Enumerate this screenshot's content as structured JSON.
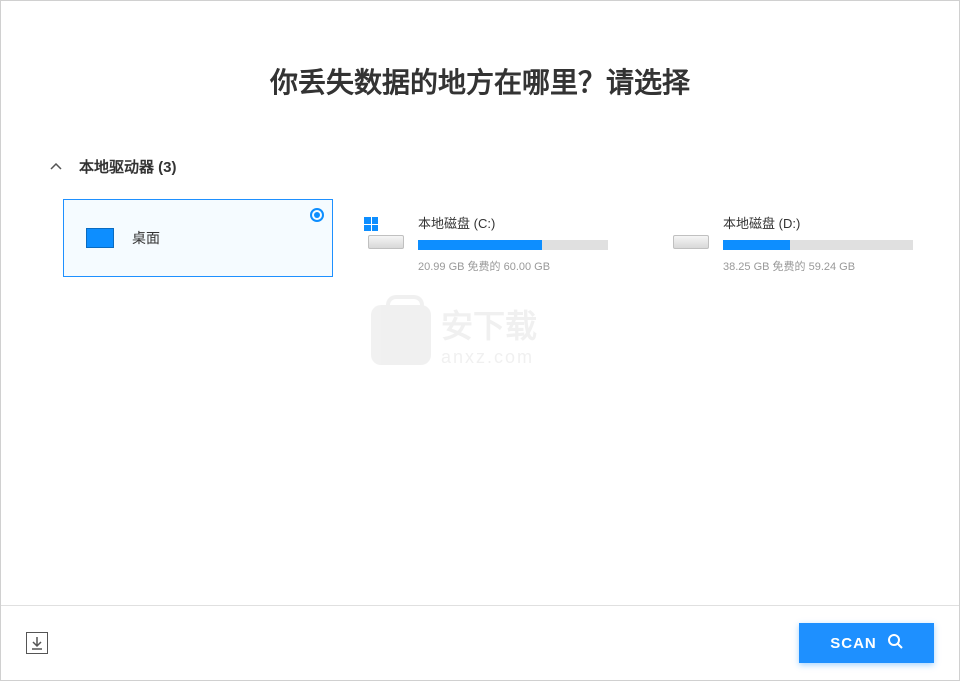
{
  "header": {
    "title": "你丢失数据的地方在哪里？请选择"
  },
  "section": {
    "label": "本地驱动器 (3)"
  },
  "drives": {
    "desktop": {
      "label": "桌面"
    },
    "diskC": {
      "name": "本地磁盘 (C:)",
      "stats": "20.99 GB 免费的 60.00 GB",
      "usedPercent": 65
    },
    "diskD": {
      "name": "本地磁盘 (D:)",
      "stats": "38.25 GB 免费的 59.24 GB",
      "usedPercent": 35
    }
  },
  "watermark": {
    "cn": "安下载",
    "en": "anxz.com"
  },
  "footer": {
    "scanLabel": "SCAN"
  }
}
